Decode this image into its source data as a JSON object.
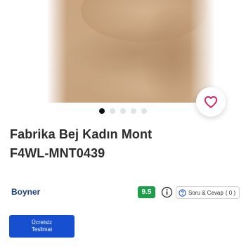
{
  "product": {
    "title_line1": "Fabrika Bej Kadın Mont",
    "title_line2": "F4WL-MNT0439",
    "image_alt_icon": "garment-photo",
    "carousel": {
      "total": 5,
      "active_index": 0
    }
  },
  "favorite": {
    "icon": "heart-icon",
    "color": "#d81b60"
  },
  "seller": {
    "name": "Boyner",
    "rating": "9.5",
    "rating_color": "#1e9e4a"
  },
  "qa": {
    "label": "Soru & Cevap",
    "count": "( 0 )"
  },
  "shipping": {
    "line1": "Ücretsiz",
    "line2": "Teslimat",
    "color": "#1650d0"
  }
}
